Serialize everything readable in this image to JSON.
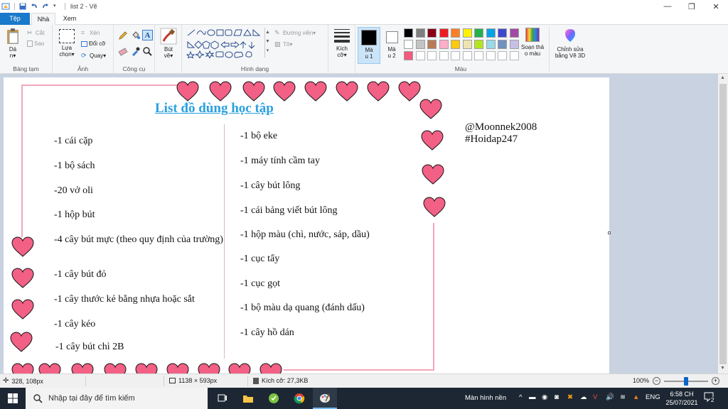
{
  "window": {
    "title": "list 2 - Vẽ"
  },
  "menu": {
    "file": "Tệp",
    "home": "Nhà",
    "view": "Xem"
  },
  "ribbon": {
    "clipboard": {
      "paste": "Dá n▾",
      "cut": "Cắt",
      "copy": "Sao",
      "label": "Bảng tạm"
    },
    "image": {
      "select": "Lựa chọn▾",
      "crop": "Xén",
      "resize": "Đổi cỡ",
      "rotate": "Quay▾",
      "label": "Ảnh"
    },
    "tools": {
      "label": "Công cụ"
    },
    "brushes": {
      "label": "Bút vẽ▾"
    },
    "shapes": {
      "outline": "Đường viền▾",
      "fill": "Tô▾",
      "label": "Hình dạng"
    },
    "size": {
      "label": "Kích cỡ▾"
    },
    "color1": {
      "label": "Mà u 1"
    },
    "color2": {
      "label": "Mà u 2"
    },
    "colors": {
      "label": "Màu",
      "row1": [
        "#000000",
        "#7f7f7f",
        "#880015",
        "#ed1c24",
        "#ff7f27",
        "#fff200",
        "#22b14c",
        "#00a2e8",
        "#3f48cc",
        "#a349a4"
      ],
      "row2": [
        "#ffffff",
        "#c3c3c3",
        "#b97a57",
        "#ffaec9",
        "#ffc90e",
        "#efe4b0",
        "#b5e61d",
        "#99d9ea",
        "#7092be",
        "#c8bfe7"
      ],
      "row3_first": "#f25a7e"
    },
    "edit_colors": "Soạn thả o màu",
    "paint3d": "Chỉnh sửa bằng Vẽ 3D"
  },
  "canvas": {
    "title": "List đồ dùng học tập",
    "left_items": [
      "-1 cái cặp",
      "-1 bộ sách",
      "-20 vở oli",
      "-1 hộp bút",
      "-4 cây bút mực (theo quy định của trường)",
      "-1 cây bút đỏ",
      "-1 cây thước kẻ bằng nhựa hoặc sắt",
      "-1 cây kéo",
      "-1 cây bút chì 2B"
    ],
    "right_items": [
      "-1 bộ eke",
      "-1 máy tính cầm tay",
      "-1 cây bút lông",
      "-1 cái bảng viết bút lông",
      "-1 hộp màu (chì, nước, sáp, dầu)",
      "-1 cục tẩy",
      "-1 cục gọt",
      "-1 bộ màu dạ quang (đánh dấu)",
      "-1 cây hồ dán"
    ],
    "credit_1": "@Moonnek2008",
    "credit_2": "#Hoidap247",
    "heart_color": "#f26086"
  },
  "status": {
    "cursor": "328, 108px",
    "image_size": "1138 × 593px",
    "file_size": "Kích cỡ: 27,3KB",
    "zoom": "100%"
  },
  "taskbar": {
    "search_placeholder": "Nhập tại đây để tìm kiếm",
    "tray_label": "Màn hình nền",
    "lang": "ENG",
    "time": "6:58 CH",
    "date": "25/07/2021",
    "notif_count": "2"
  }
}
